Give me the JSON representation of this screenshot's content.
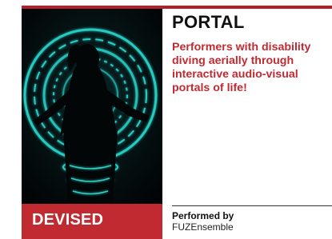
{
  "show": {
    "title": "PORTAL",
    "description": "Performers with disability diving aerially through interactive audio-visual portals of life!",
    "category": "DEVISED",
    "performed_by_label": "Performed by",
    "performer": "FUZEnsemble"
  },
  "colors": {
    "accent_red": "#c22a31",
    "top_bar": "#b3202a",
    "photo_background": "#020607",
    "ring_cyan": "#29d9cf"
  },
  "photo": {
    "subject": "performer silhouette with outstretched arms inside glowing cyan rings"
  }
}
